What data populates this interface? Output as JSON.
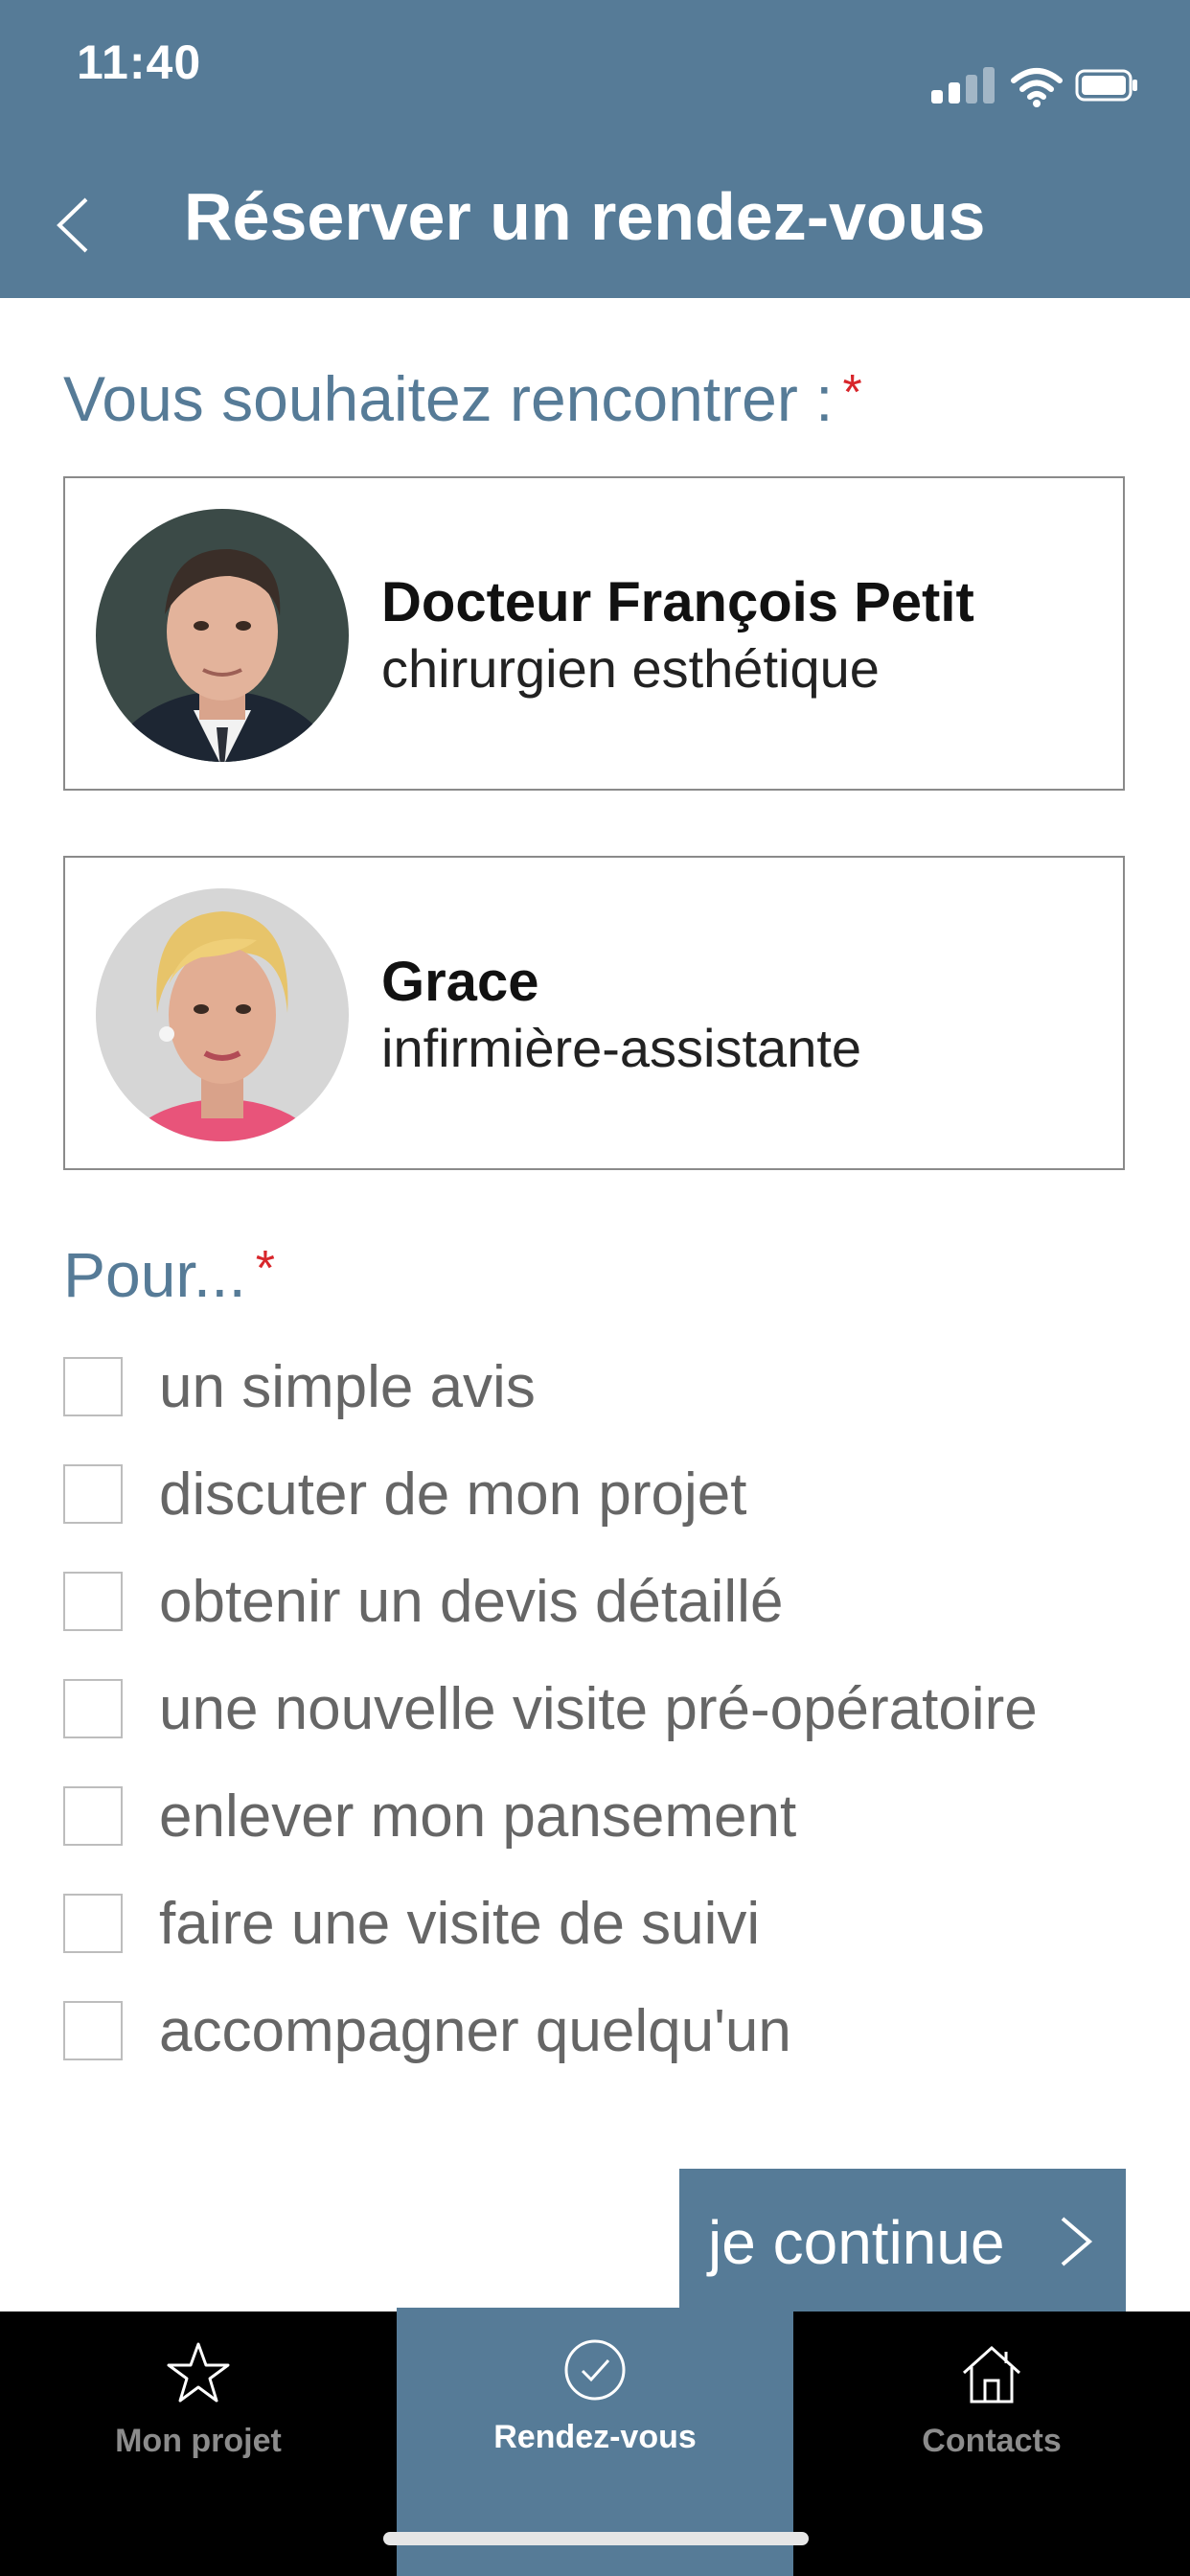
{
  "status_bar": {
    "time": "11:40"
  },
  "header": {
    "title": "Réserver un rendez-vous"
  },
  "meet_section": {
    "label": "Vous souhaitez rencontrer :",
    "required_mark": "*"
  },
  "people": [
    {
      "name": "Docteur François Petit",
      "role": "chirurgien esthétique"
    },
    {
      "name": "Grace",
      "role": "infirmière-assistante"
    }
  ],
  "purpose_section": {
    "label": "Pour...",
    "required_mark": "*",
    "options": [
      "un simple avis",
      "discuter de mon projet",
      "obtenir un devis détaillé",
      "une nouvelle visite pré-opératoire",
      "enlever mon pansement",
      "faire une visite de suivi",
      "accompagner quelqu'un"
    ]
  },
  "continue_button": {
    "label": "je continue"
  },
  "tab_bar": {
    "tabs": [
      {
        "label": "Mon projet",
        "icon": "star-icon"
      },
      {
        "label": "Rendez-vous",
        "icon": "check-circle-icon",
        "active": true
      },
      {
        "label": "Contacts",
        "icon": "home-icon"
      }
    ]
  },
  "colors": {
    "primary": "#567b97",
    "required": "#d8262b",
    "tab_bg": "#000000"
  }
}
